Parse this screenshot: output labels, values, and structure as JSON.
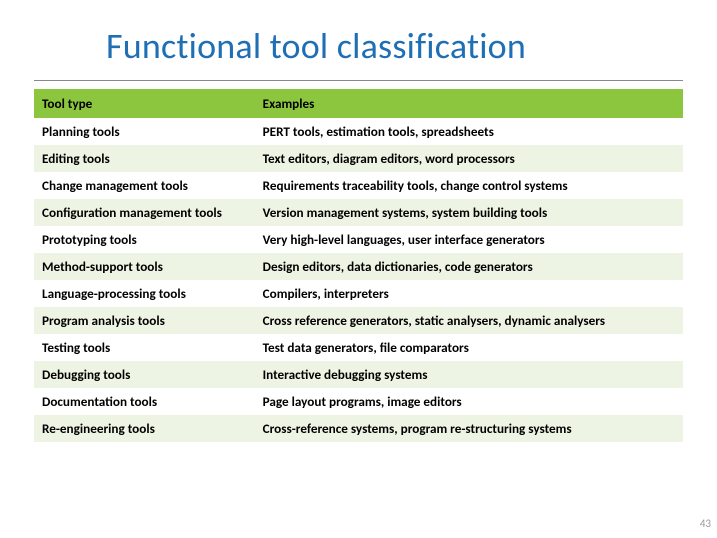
{
  "title": "Functional tool classification",
  "headers": {
    "col1": "Tool type",
    "col2": "Examples"
  },
  "rows": [
    {
      "type": "Planning tools",
      "examples": "PERT tools, estimation tools, spreadsheets"
    },
    {
      "type": "Editing tools",
      "examples": "Text editors, diagram editors, word processors"
    },
    {
      "type": "Change management tools",
      "examples": "Requirements traceability tools, change control systems"
    },
    {
      "type": "Configuration management tools",
      "examples": "Version management systems, system building tools"
    },
    {
      "type": "Prototyping tools",
      "examples": "Very high-level languages, user interface generators"
    },
    {
      "type": "Method-support tools",
      "examples": "Design editors, data dictionaries, code generators"
    },
    {
      "type": "Language-processing tools",
      "examples": "Compilers, interpreters"
    },
    {
      "type": "Program analysis tools",
      "examples": "Cross reference generators, static analysers, dynamic analysers"
    },
    {
      "type": "Testing tools",
      "examples": "Test data generators, file comparators"
    },
    {
      "type": "Debugging tools",
      "examples": "Interactive debugging systems"
    },
    {
      "type": "Documentation tools",
      "examples": "Page layout programs, image editors"
    },
    {
      "type": "Re-engineering tools",
      "examples": "Cross-reference systems, program re-structuring systems"
    }
  ],
  "page_number": "43"
}
